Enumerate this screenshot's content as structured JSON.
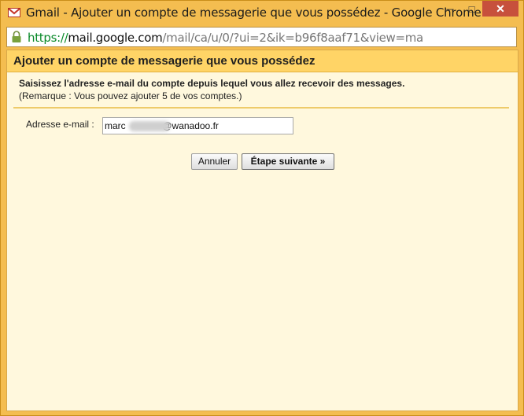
{
  "window": {
    "title": "Gmail - Ajouter un compte de messagerie que vous possédez - Google Chrome",
    "controls": {
      "minimize": "─",
      "maximize": "□",
      "close": "✕"
    }
  },
  "addressbar": {
    "scheme": "https://",
    "host": "mail.google.com",
    "path": "/mail/ca/u/0/?ui=2&ik=b96f8aaf71&view=ma",
    "lock_icon": "lock-icon"
  },
  "dialog": {
    "title": "Ajouter un compte de messagerie que vous possédez",
    "instruction": "Saisissez l'adresse e-mail du compte depuis lequel vous allez recevoir des messages.",
    "note": "(Remarque : Vous pouvez ajouter 5 de vos comptes.)",
    "email_label": "Adresse e-mail :",
    "email_value": "marc              @wanadoo.fr",
    "cancel_label": "Annuler",
    "next_label": "Étape suivante »"
  },
  "colors": {
    "window_frame": "#f4bd50",
    "header_bg": "#ffd466",
    "content_bg": "#fff8dd",
    "close_button": "#c7503c"
  }
}
